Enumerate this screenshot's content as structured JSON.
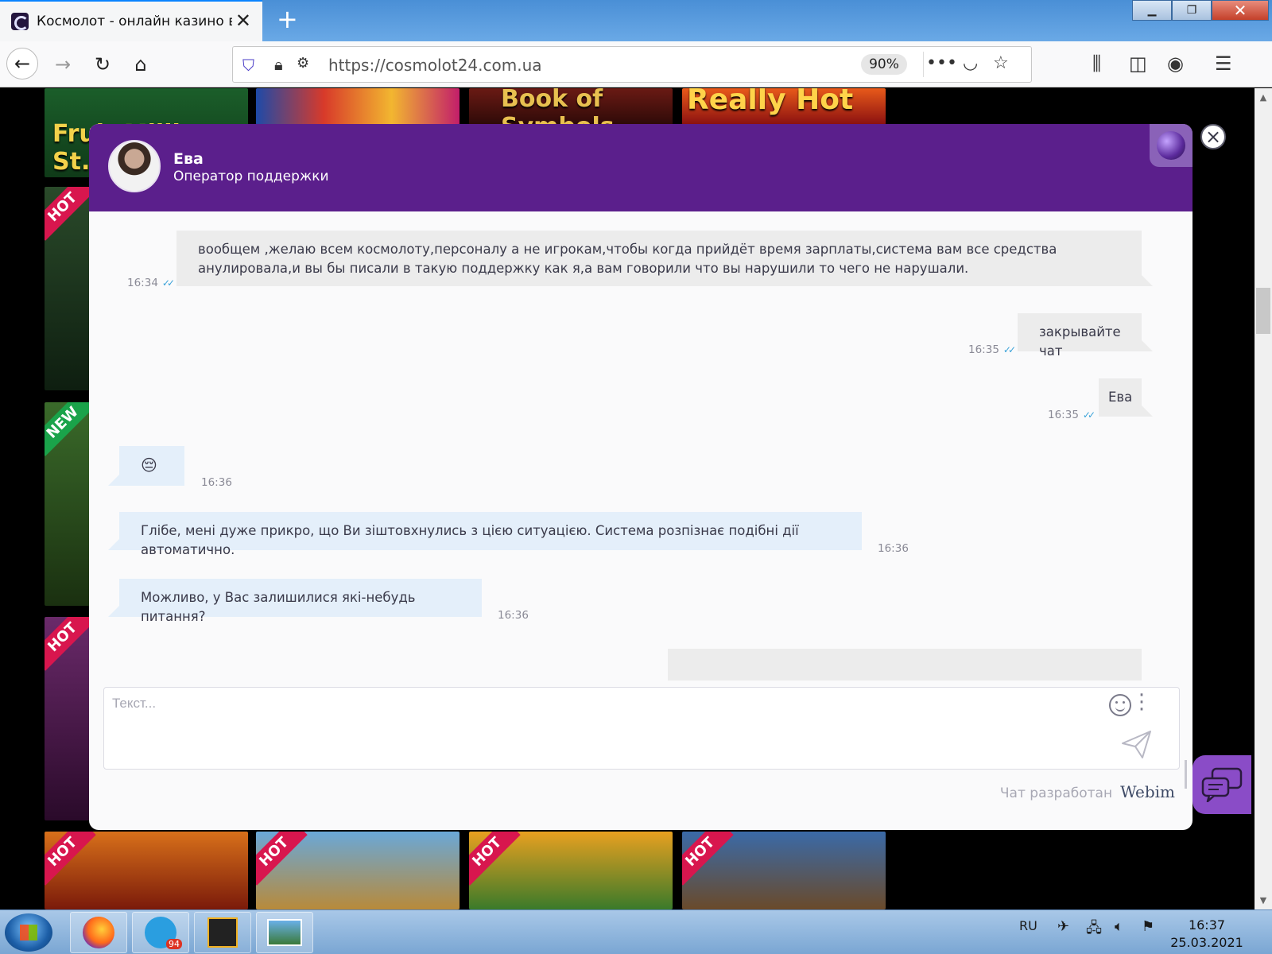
{
  "browser": {
    "tab_title": "Космолот - онлайн казино в Украине",
    "url": "https://cosmolot24.com.ua",
    "zoom": "90%"
  },
  "chat": {
    "operator": {
      "name": "Ева",
      "role": "Оператор поддержки"
    },
    "messages": [
      {
        "text": "вообщем ,желаю всем космолоту,персоналу а не игрокам,чтобы когда прийдёт время зарплаты,система вам все средства анулировала,и вы бы писали в такую поддержку как я,а вам говорили что вы нарушили то чего не нарушали.",
        "time": "16:34"
      },
      {
        "text": "закрывайте чат",
        "time": "16:35"
      },
      {
        "text": "Ева",
        "time": "16:35"
      },
      {
        "text": "😔",
        "time": "16:36"
      },
      {
        "text": "Глібе, мені дуже прикро, що Ви зіштовхнулись з цією ситуацією. Система розпізнає подібні дії автоматично.",
        "time": "16:36"
      },
      {
        "text": "Можливо, у Вас залишилися які-небудь питання?",
        "time": "16:36"
      }
    ],
    "input_placeholder": "Текст...",
    "footer_text": "Чат разработан",
    "footer_brand": "Webim"
  },
  "tiles": {
    "top_labels": [
      "Fruit Million St.Patrick",
      "",
      "Book of Symbols",
      "Really Hot"
    ],
    "ribbon_hot": "HOT",
    "ribbon_new": "NEW"
  },
  "taskbar": {
    "telegram_badge": "94",
    "language": "RU",
    "time": "16:37",
    "date": "25.03.2021"
  }
}
